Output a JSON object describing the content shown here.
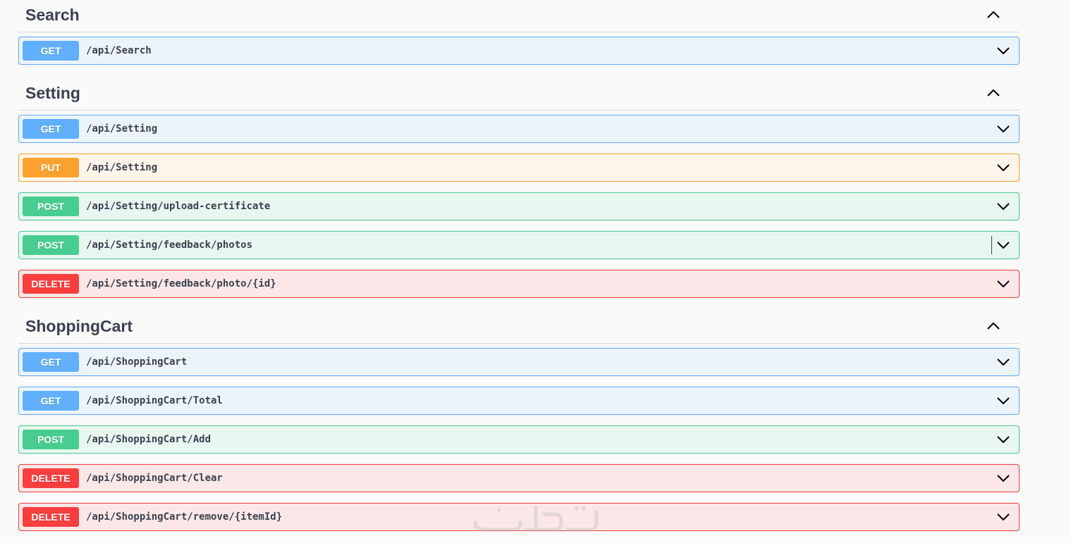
{
  "sections": [
    {
      "title": "Search",
      "ops": [
        {
          "method": "GET",
          "path": "/api/Search"
        }
      ]
    },
    {
      "title": "Setting",
      "ops": [
        {
          "method": "GET",
          "path": "/api/Setting"
        },
        {
          "method": "PUT",
          "path": "/api/Setting"
        },
        {
          "method": "POST",
          "path": "/api/Setting/upload-certificate"
        },
        {
          "method": "POST",
          "path": "/api/Setting/feedback/photos"
        },
        {
          "method": "DELETE",
          "path": "/api/Setting/feedback/photo/{id}"
        }
      ]
    },
    {
      "title": "ShoppingCart",
      "ops": [
        {
          "method": "GET",
          "path": "/api/ShoppingCart"
        },
        {
          "method": "GET",
          "path": "/api/ShoppingCart/Total"
        },
        {
          "method": "POST",
          "path": "/api/ShoppingCart/Add"
        },
        {
          "method": "DELETE",
          "path": "/api/ShoppingCart/Clear"
        },
        {
          "method": "DELETE",
          "path": "/api/ShoppingCart/remove/{itemId}"
        }
      ]
    }
  ],
  "icons": {
    "section_toggle": "chevron-up-icon",
    "op_toggle": "chevron-down-icon"
  },
  "colors": {
    "get": "#61affe",
    "put": "#fca130",
    "post": "#49cc90",
    "delete": "#f93e3e"
  }
}
